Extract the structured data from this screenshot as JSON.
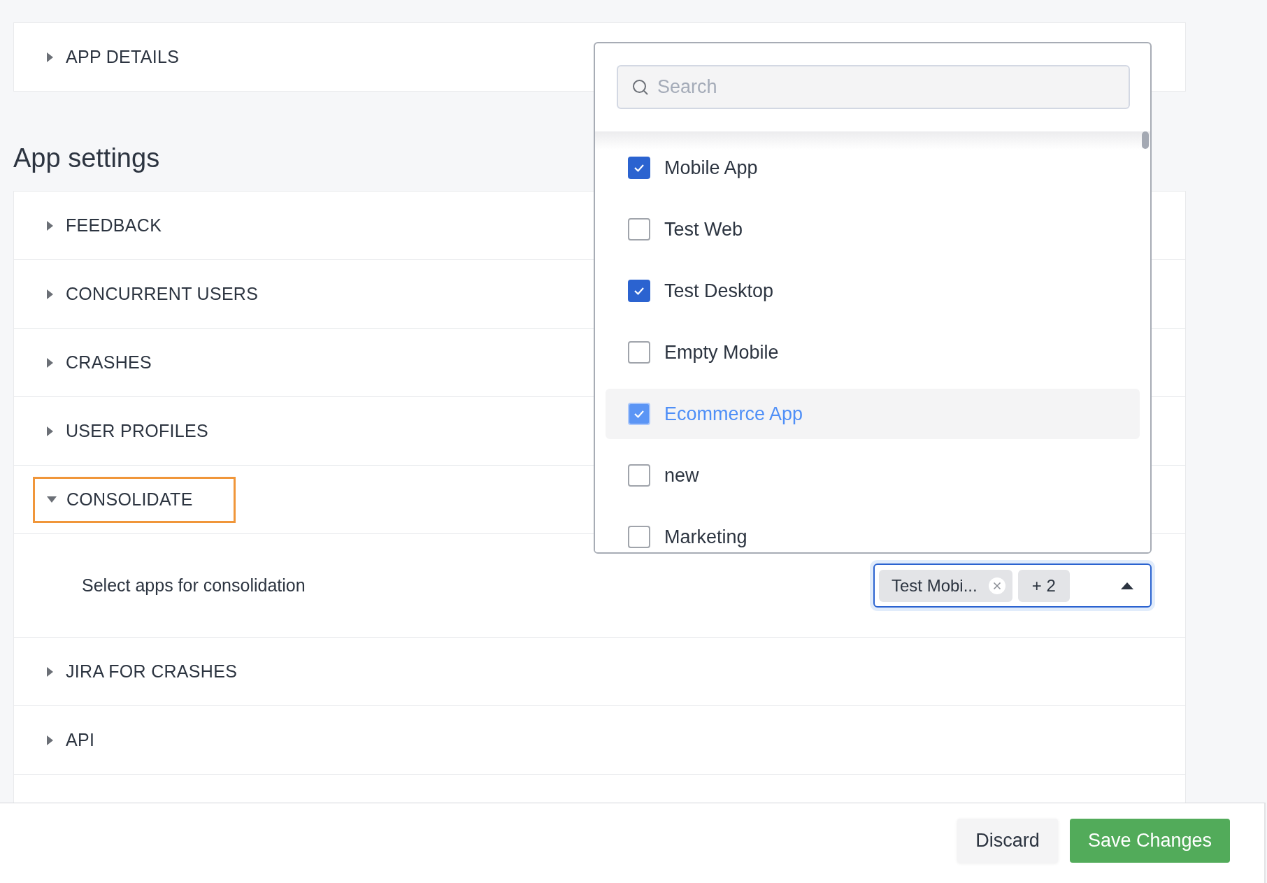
{
  "top_sections": [
    {
      "label": "APP DETAILS",
      "expanded": false,
      "focused": false
    }
  ],
  "heading": "App settings",
  "sections": [
    {
      "label": "FEEDBACK",
      "expanded": false,
      "focused": false
    },
    {
      "label": "CONCURRENT USERS",
      "expanded": false,
      "focused": false
    },
    {
      "label": "CRASHES",
      "expanded": false,
      "focused": false
    },
    {
      "label": "USER PROFILES",
      "expanded": false,
      "focused": false
    },
    {
      "label": "CONSOLIDATE",
      "expanded": true,
      "focused": true,
      "content": {
        "label": "Select apps for consolidation",
        "select": {
          "open": true,
          "chips": [
            {
              "text": "Test Mobi...",
              "removable": true
            },
            {
              "text": "+ 2",
              "removable": false
            }
          ]
        }
      }
    },
    {
      "label": "JIRA FOR CRASHES",
      "expanded": false,
      "focused": false
    },
    {
      "label": "API",
      "expanded": false,
      "focused": false
    }
  ],
  "dropdown": {
    "search": {
      "placeholder": "Search"
    },
    "items": [
      {
        "label": "Mobile App",
        "checked": true,
        "highlighted": false
      },
      {
        "label": "Test Web",
        "checked": false,
        "highlighted": false
      },
      {
        "label": "Test Desktop",
        "checked": true,
        "highlighted": false
      },
      {
        "label": "Empty Mobile",
        "checked": false,
        "highlighted": false
      },
      {
        "label": "Ecommerce App",
        "checked": true,
        "highlighted": true
      },
      {
        "label": "new",
        "checked": false,
        "highlighted": false
      },
      {
        "label": "Marketing",
        "checked": false,
        "highlighted": false
      }
    ]
  },
  "footer": {
    "buttons": [
      {
        "label": "Discard",
        "kind": "secondary"
      },
      {
        "label": "Save Changes",
        "kind": "primary"
      }
    ]
  }
}
